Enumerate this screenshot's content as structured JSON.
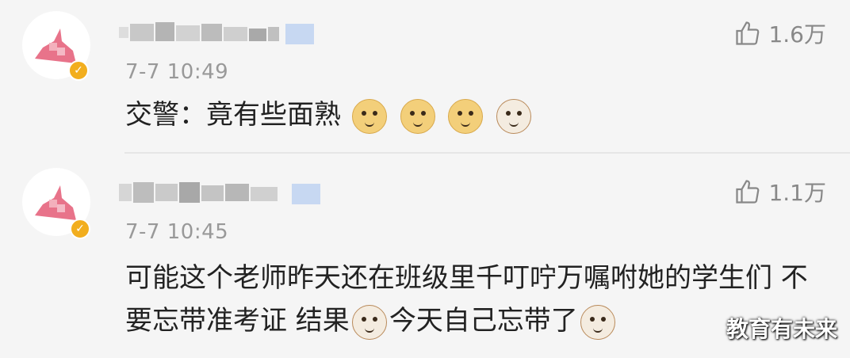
{
  "comments": [
    {
      "time": "7-7 10:49",
      "likes": "1.6万",
      "text_prefix": "交警：竟有些面熟",
      "text_suffix": "",
      "emojis": [
        "doge",
        "doge",
        "doge",
        "cat"
      ],
      "avatar_signature": "~signature~"
    },
    {
      "time": "7-7 10:45",
      "likes": "1.1万",
      "text_prefix": "可能这个老师昨天还在班级里千叮咛万嘱咐她的学生们 不要忘带准考证 结果",
      "text_suffix": "今天自己忘带了",
      "emojis": [
        "cat",
        "cat"
      ],
      "avatar_signature": "~signature~"
    }
  ],
  "icons": {
    "like": "thumbs-up-icon",
    "verified": "verified-badge-icon"
  },
  "colors": {
    "verified": "#f2ae1e",
    "horn": "#e8738a",
    "background": "#f5f5f5"
  },
  "watermark": "教育有未来"
}
